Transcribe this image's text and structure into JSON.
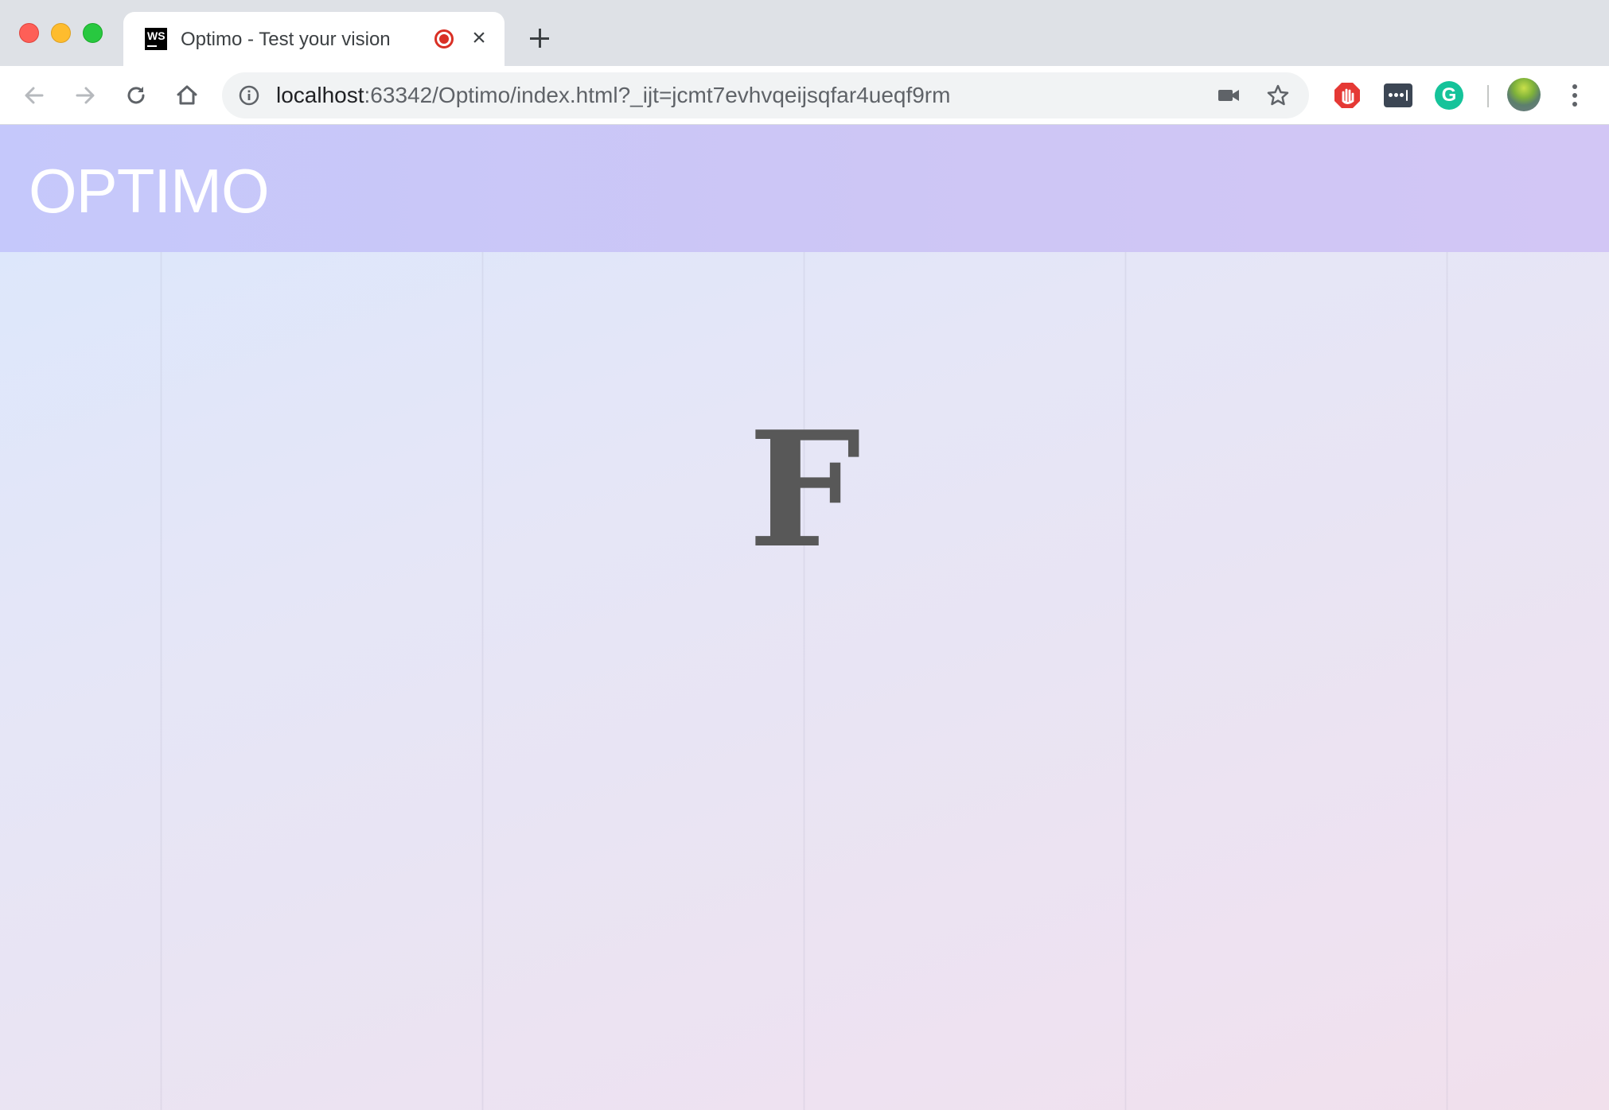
{
  "browser": {
    "tab": {
      "favicon_text": "WS",
      "title": "Optimo - Test your vision",
      "recording_indicator": "record-icon",
      "close_icon": "close-icon"
    },
    "new_tab_icon": "plus-icon",
    "toolbar": {
      "back_icon": "back-arrow-icon",
      "forward_icon": "forward-arrow-icon",
      "reload_icon": "reload-icon",
      "home_icon": "home-icon"
    },
    "omnibox": {
      "info_icon": "info-icon",
      "url_host": "localhost",
      "url_rest": ":63342/Optimo/index.html?_ijt=jcmt7evhvqeijsqfar4ueqf9rm",
      "camera_icon": "camera-icon",
      "bookmark_icon": "star-icon"
    },
    "extensions": [
      "adblock-icon",
      "lastpass-icon",
      "grammarly-icon"
    ],
    "extension_grammarly_letter": "G",
    "profile_icon": "avatar",
    "menu_icon": "kebab-menu-icon"
  },
  "page": {
    "logo": "OPTIMO",
    "optotype_letter": "F",
    "colors": {
      "header_start": "#c5c8fb",
      "header_end": "#d2c6f5",
      "letter": "#585858",
      "background_start": "#dde7fb",
      "background_end": "#f1e0ec"
    }
  }
}
